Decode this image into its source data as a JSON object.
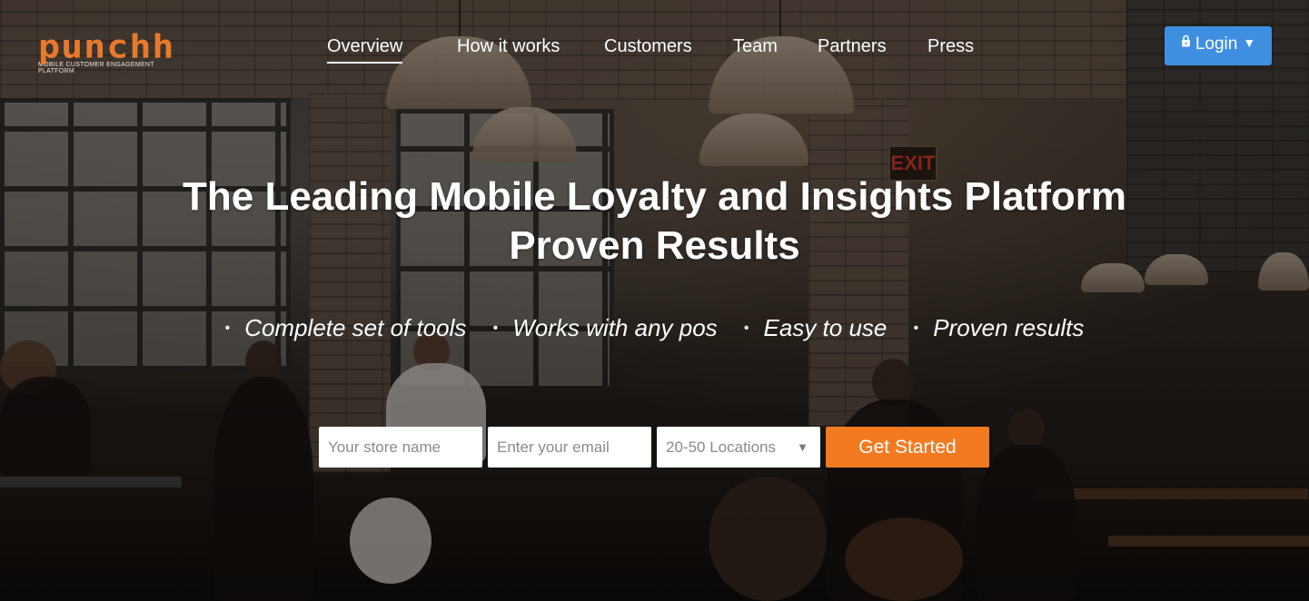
{
  "brand": {
    "logo_text": "punchh",
    "tagline": "MOBILE CUSTOMER ENGAGEMENT PLATFORM",
    "accent_color": "#f47a20"
  },
  "nav": {
    "items": [
      {
        "label": "Overview",
        "active": true
      },
      {
        "label": "How it works",
        "active": false
      },
      {
        "label": "Customers",
        "active": false
      },
      {
        "label": "Team",
        "active": false
      },
      {
        "label": "Partners",
        "active": false
      },
      {
        "label": "Press",
        "active": false
      }
    ]
  },
  "login": {
    "label": "Login",
    "icon": "lock-icon",
    "dropdown_icon": "caret-down-icon",
    "color": "#3f8fe0"
  },
  "hero": {
    "headline_line1": "The Leading Mobile Loyalty and Insights Platform",
    "headline_line2": "Proven Results",
    "features": [
      "Complete set of tools",
      "Works with any pos",
      "Easy to use",
      "Proven results"
    ],
    "background_signage": "EXIT"
  },
  "signup_form": {
    "store_name_placeholder": "Your store name",
    "email_placeholder": "Enter your email",
    "locations_selected": "20-50 Locations",
    "submit_label": "Get Started",
    "submit_color": "#f47a20"
  }
}
